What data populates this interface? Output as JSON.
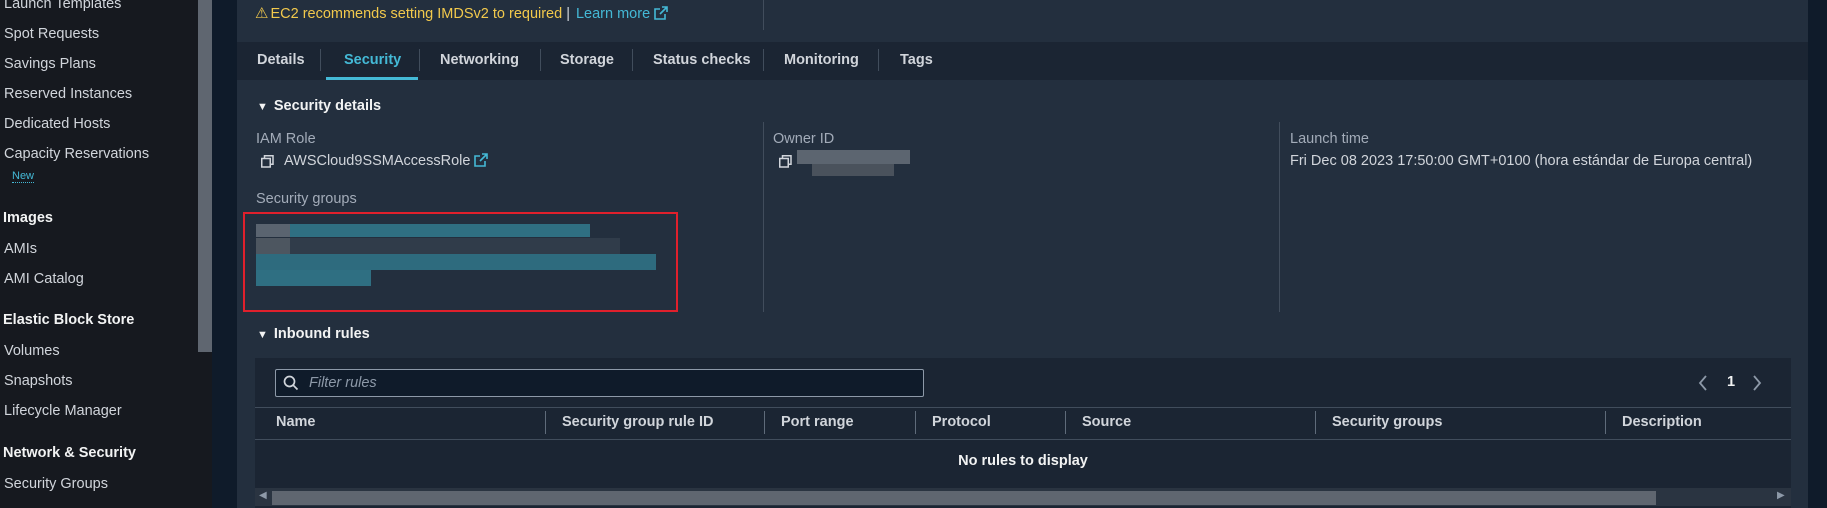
{
  "sidebar": {
    "items": [
      {
        "label": "Launch Templates"
      },
      {
        "label": "Spot Requests"
      },
      {
        "label": "Savings Plans"
      },
      {
        "label": "Reserved Instances"
      },
      {
        "label": "Dedicated Hosts"
      },
      {
        "label": "Capacity Reservations"
      }
    ],
    "new_badge": "New",
    "sections": {
      "images": {
        "title": "Images",
        "items": [
          {
            "label": "AMIs"
          },
          {
            "label": "AMI Catalog"
          }
        ]
      },
      "ebs": {
        "title": "Elastic Block Store",
        "items": [
          {
            "label": "Volumes"
          },
          {
            "label": "Snapshots"
          },
          {
            "label": "Lifecycle Manager"
          }
        ]
      },
      "network": {
        "title": "Network & Security",
        "items": [
          {
            "label": "Security Groups"
          }
        ]
      }
    }
  },
  "banner": {
    "warning": "EC2 recommends setting IMDSv2 to required",
    "separator": "|",
    "learn_more": "Learn more"
  },
  "tabs": [
    {
      "label": "Details"
    },
    {
      "label": "Security"
    },
    {
      "label": "Networking"
    },
    {
      "label": "Storage"
    },
    {
      "label": "Status checks"
    },
    {
      "label": "Monitoring"
    },
    {
      "label": "Tags"
    }
  ],
  "active_tab": "Security",
  "security_details": {
    "title": "Security details",
    "iam_role_label": "IAM Role",
    "iam_role_value": "AWSCloud9SSMAccessRole",
    "owner_id_label": "Owner ID",
    "launch_time_label": "Launch time",
    "launch_time_value": "Fri Dec 08 2023 17:50:00 GMT+0100 (hora estándar de Europa central)",
    "security_groups_label": "Security groups"
  },
  "inbound_rules": {
    "title": "Inbound rules",
    "filter_placeholder": "Filter rules",
    "page": "1",
    "columns": [
      {
        "label": "Name"
      },
      {
        "label": "Security group rule ID"
      },
      {
        "label": "Port range"
      },
      {
        "label": "Protocol"
      },
      {
        "label": "Source"
      },
      {
        "label": "Security groups"
      },
      {
        "label": "Description"
      }
    ],
    "empty_message": "No rules to display"
  },
  "colors": {
    "accent": "#44b9d6",
    "warning": "#f2c94c",
    "highlight_border": "#e0202c"
  }
}
